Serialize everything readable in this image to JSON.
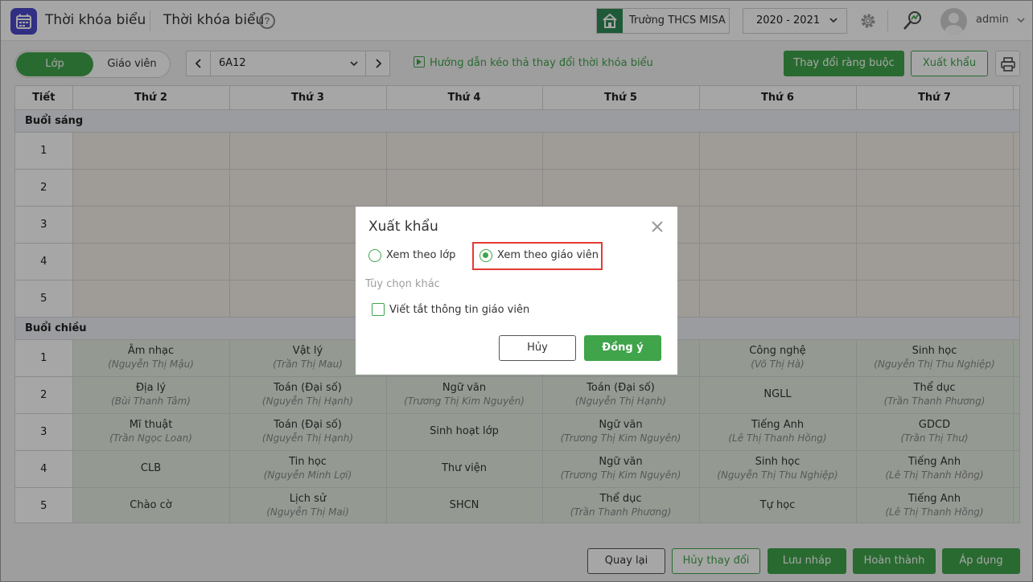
{
  "header": {
    "app_title": "Thời khóa biểu",
    "page_title": "Thời khóa biểu",
    "help_symbol": "?",
    "school": "Trường THCS MISA",
    "school_year": "2020 - 2021",
    "user": "admin",
    "icons": [
      "calendar-icon",
      "help-icon",
      "school-icon",
      "chevron-down-icon",
      "gear-icon",
      "connect-icon",
      "avatar"
    ]
  },
  "toolbar": {
    "view_tabs": [
      "Lớp",
      "Giáo viên"
    ],
    "active_tab": "Lớp",
    "class_value": "6A12",
    "guide_text": "Hướng dẫn kéo thả thay đổi thời khóa biểu",
    "constraint_button": "Thay đổi ràng buộc",
    "export_button": "Xuất khẩu"
  },
  "timetable": {
    "headers": [
      "Tiết",
      "Thứ 2",
      "Thứ 3",
      "Thứ 4",
      "Thứ 5",
      "Thứ 6",
      "Thứ 7"
    ],
    "morning_label": "Buổi sáng",
    "afternoon_label": "Buổi chiều",
    "morning_periods": [
      "1",
      "2",
      "3",
      "4",
      "5"
    ],
    "afternoon": [
      {
        "period": "1",
        "cells": [
          {
            "subject": "Âm nhạc",
            "teacher": "(Nguyễn Thị Mậu)"
          },
          {
            "subject": "Vật lý",
            "teacher": "(Trần Thị Mau)"
          },
          {
            "subject": "",
            "teacher": ""
          },
          {
            "subject": "",
            "teacher": ""
          },
          {
            "subject": "Công nghệ",
            "teacher": "(Võ Thị Hà)"
          },
          {
            "subject": "Sinh học",
            "teacher": "(Nguyễn Thị Thu Nghiệp)"
          }
        ]
      },
      {
        "period": "2",
        "cells": [
          {
            "subject": "Địa lý",
            "teacher": "(Bùi Thanh Tâm)"
          },
          {
            "subject": "Toán (Đại số)",
            "teacher": "(Nguyễn Thị Hạnh)"
          },
          {
            "subject": "Ngữ văn",
            "teacher": "(Trương Thị Kim Nguyên)"
          },
          {
            "subject": "Toán (Đại số)",
            "teacher": "(Nguyễn Thị Hạnh)"
          },
          {
            "subject": "NGLL",
            "teacher": ""
          },
          {
            "subject": "Thể dục",
            "teacher": "(Trần Thanh Phương)"
          }
        ]
      },
      {
        "period": "3",
        "cells": [
          {
            "subject": "Mĩ thuật",
            "teacher": "(Trần Ngọc Loan)"
          },
          {
            "subject": "Toán (Đại số)",
            "teacher": "(Nguyễn Thị Hạnh)"
          },
          {
            "subject": "Sinh hoạt lớp",
            "teacher": ""
          },
          {
            "subject": "Ngữ văn",
            "teacher": "(Trương Thị Kim Nguyên)"
          },
          {
            "subject": "Tiếng Anh",
            "teacher": "(Lê Thị Thanh Hồng)"
          },
          {
            "subject": "GDCD",
            "teacher": "(Trần Thị Thư)"
          }
        ]
      },
      {
        "period": "4",
        "cells": [
          {
            "subject": "CLB",
            "teacher": ""
          },
          {
            "subject": "Tin học",
            "teacher": "(Nguyễn Minh Lợi)"
          },
          {
            "subject": "Thư viện",
            "teacher": ""
          },
          {
            "subject": "Ngữ văn",
            "teacher": "(Trương Thị Kim Nguyên)"
          },
          {
            "subject": "Sinh học",
            "teacher": "(Nguyễn Thị Thu Nghiệp)"
          },
          {
            "subject": "Tiếng Anh",
            "teacher": "(Lê Thị Thanh Hồng)"
          }
        ]
      },
      {
        "period": "5",
        "cells": [
          {
            "subject": "Chào cờ",
            "teacher": ""
          },
          {
            "subject": "Lịch sử",
            "teacher": "(Nguyễn Thị Mai)"
          },
          {
            "subject": "SHCN",
            "teacher": ""
          },
          {
            "subject": "Thể dục",
            "teacher": "(Trần Thanh Phương)"
          },
          {
            "subject": "Tự học",
            "teacher": ""
          },
          {
            "subject": "Tiếng Anh",
            "teacher": "(Lê Thị Thanh Hồng)"
          }
        ]
      }
    ]
  },
  "dialog": {
    "title": "Xuất khẩu",
    "option_by_class": "Xem theo lớp",
    "option_by_teacher": "Xem theo giáo viên",
    "selected_option": "Xem theo giáo viên",
    "other_options_label": "Tùy chọn khác",
    "abbreviate_label": "Viết tắt thông tin giáo viên",
    "abbreviate_checked": false,
    "cancel": "Hủy",
    "ok": "Đồng ý"
  },
  "footer": {
    "back": "Quay lại",
    "undo_changes": "Hủy thay đổi",
    "save_draft": "Lưu nháp",
    "complete": "Hoàn thành",
    "apply": "Áp dụng"
  },
  "colors": {
    "accent": "#3fa44a",
    "app_icon": "#4b49c9",
    "highlight_border": "#e53935",
    "morning_cell": "#f5efe7",
    "afternoon_cell": "#e3ede0"
  }
}
